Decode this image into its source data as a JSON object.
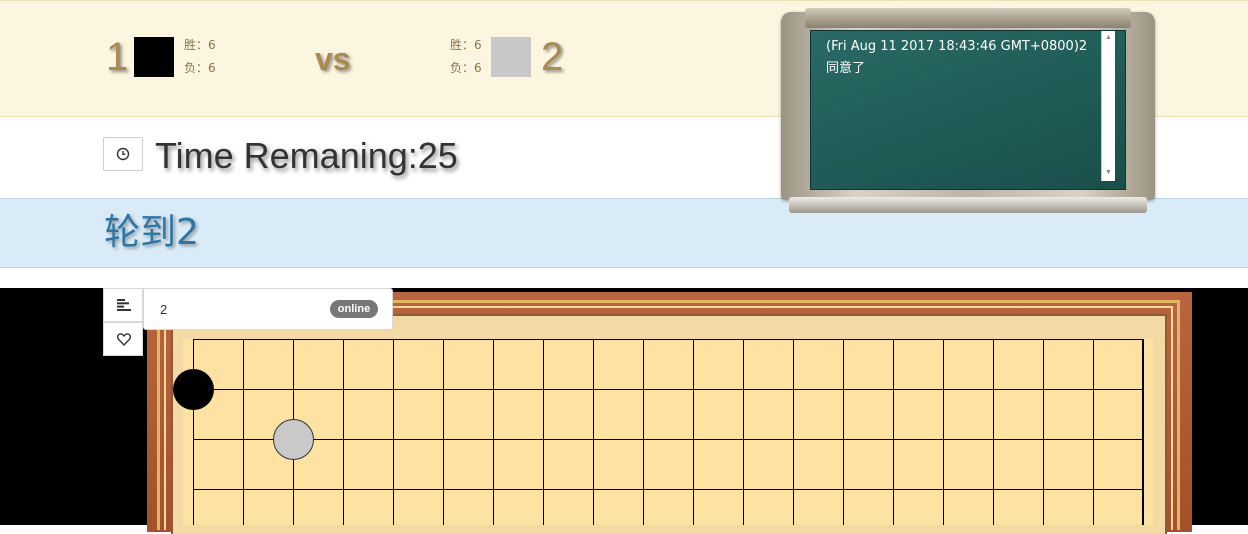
{
  "players": {
    "left": {
      "name": "1",
      "color": "#000000",
      "wins_label": "胜：6",
      "losses_label": "负：6",
      "wins": 6,
      "losses": 6
    },
    "right": {
      "name": "2",
      "color": "#c8c8c8",
      "wins_label": "胜：6",
      "losses_label": "负：6",
      "wins": 6,
      "losses": 6
    },
    "vs_label": "vs"
  },
  "timer": {
    "icon": "clock-icon",
    "text": "Time Remaning:25",
    "seconds": 25
  },
  "turn": {
    "text": "轮到2"
  },
  "chat": {
    "messages": [
      "(Fri Aug 11 2017 18:43:46 GMT+0800)2",
      "同意了"
    ]
  },
  "sidebar": {
    "menu_icon": "align-left-icon",
    "like_icon": "heart-icon"
  },
  "opponent": {
    "name": "2",
    "status": "online"
  },
  "board": {
    "grid_color": "#000000",
    "board_color": "#fee2a2",
    "stones": [
      {
        "color": "black",
        "col": 0,
        "row": 1
      },
      {
        "color": "white",
        "col": 2,
        "row": 2
      }
    ]
  },
  "colors": {
    "score_bg": "#fcf6e1",
    "turn_bg": "#d9ebf6",
    "turn_text": "#2f76a6",
    "frame": "#a5502c"
  }
}
